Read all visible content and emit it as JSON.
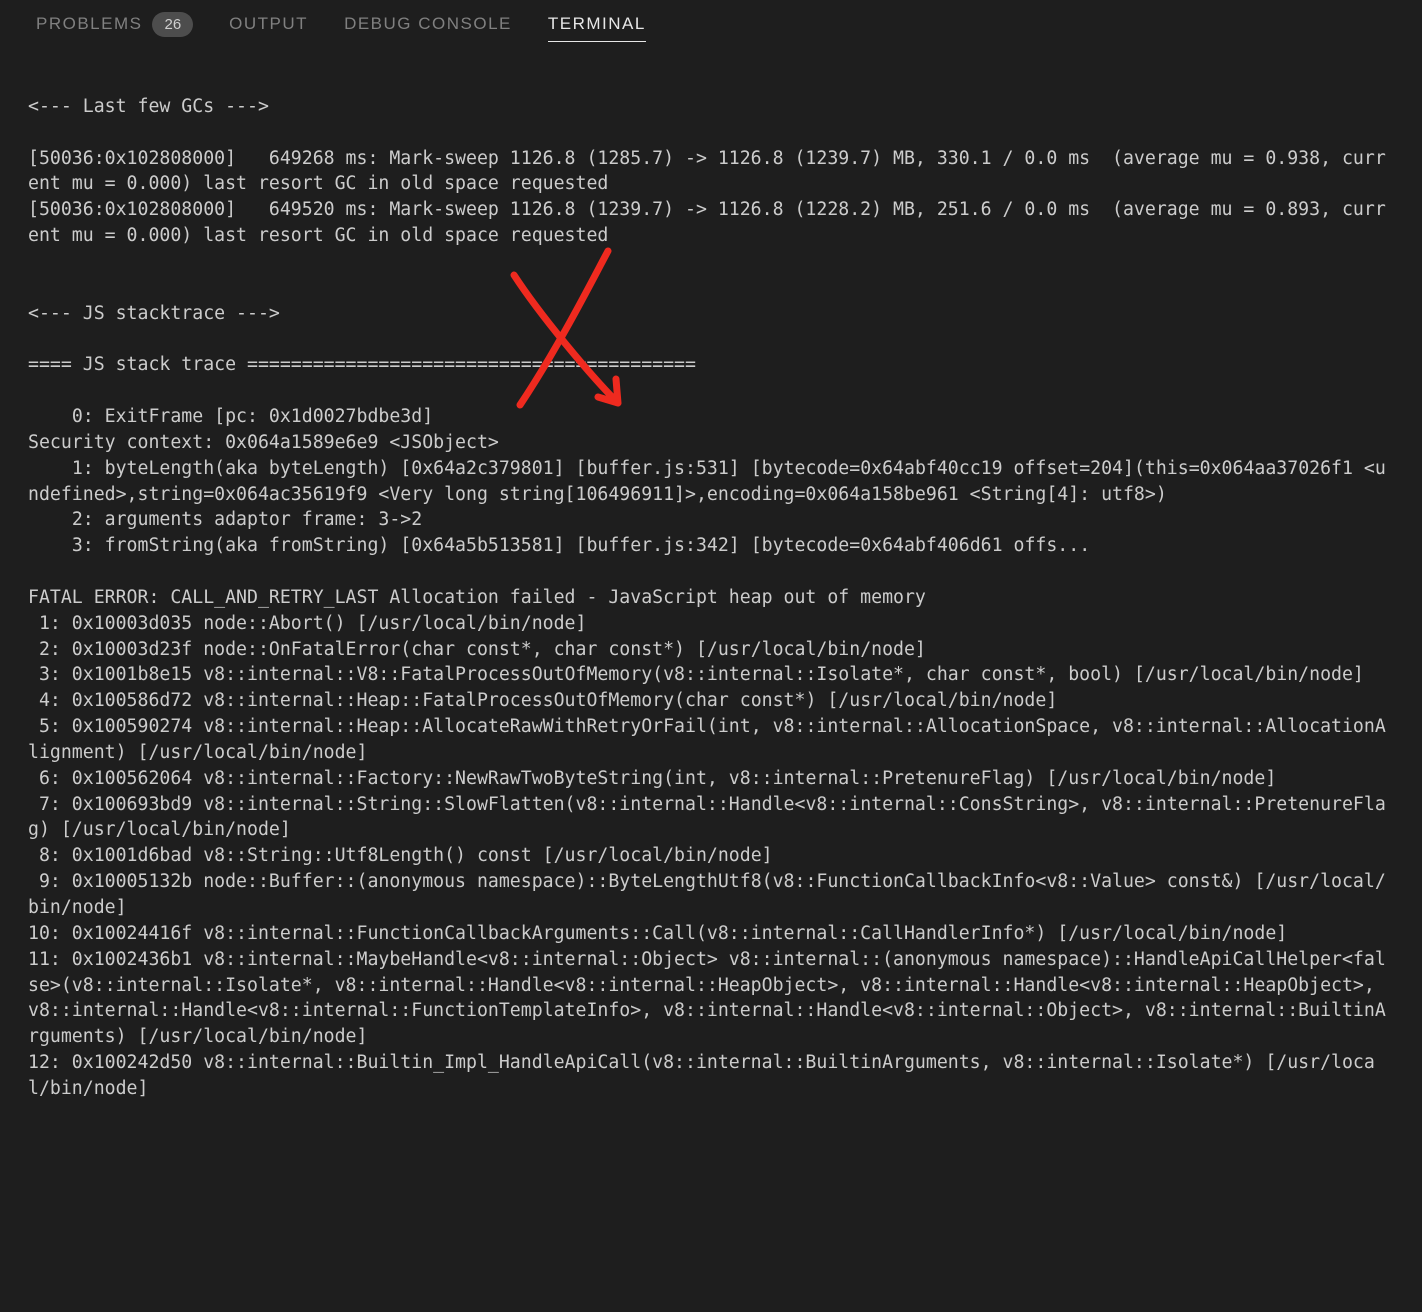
{
  "tabs": {
    "problems": {
      "label": "PROBLEMS",
      "badge": "26"
    },
    "output": {
      "label": "OUTPUT"
    },
    "debug": {
      "label": "DEBUG CONSOLE"
    },
    "terminal": {
      "label": "TERMINAL"
    }
  },
  "terminal_output": "\n<--- Last few GCs --->\n\n[50036:0x102808000]   649268 ms: Mark-sweep 1126.8 (1285.7) -> 1126.8 (1239.7) MB, 330.1 / 0.0 ms  (average mu = 0.938, current mu = 0.000) last resort GC in old space requested\n[50036:0x102808000]   649520 ms: Mark-sweep 1126.8 (1239.7) -> 1126.8 (1228.2) MB, 251.6 / 0.0 ms  (average mu = 0.893, current mu = 0.000) last resort GC in old space requested\n\n\n<--- JS stacktrace --->\n\n==== JS stack trace =========================================\n\n    0: ExitFrame [pc: 0x1d0027bdbe3d]\nSecurity context: 0x064a1589e6e9 <JSObject>\n    1: byteLength(aka byteLength) [0x64a2c379801] [buffer.js:531] [bytecode=0x64abf40cc19 offset=204](this=0x064aa37026f1 <undefined>,string=0x064ac35619f9 <Very long string[106496911]>,encoding=0x064a158be961 <String[4]: utf8>)\n    2: arguments adaptor frame: 3->2\n    3: fromString(aka fromString) [0x64a5b513581] [buffer.js:342] [bytecode=0x64abf406d61 offs...\n\nFATAL ERROR: CALL_AND_RETRY_LAST Allocation failed - JavaScript heap out of memory\n 1: 0x10003d035 node::Abort() [/usr/local/bin/node]\n 2: 0x10003d23f node::OnFatalError(char const*, char const*) [/usr/local/bin/node]\n 3: 0x1001b8e15 v8::internal::V8::FatalProcessOutOfMemory(v8::internal::Isolate*, char const*, bool) [/usr/local/bin/node]\n 4: 0x100586d72 v8::internal::Heap::FatalProcessOutOfMemory(char const*) [/usr/local/bin/node]\n 5: 0x100590274 v8::internal::Heap::AllocateRawWithRetryOrFail(int, v8::internal::AllocationSpace, v8::internal::AllocationAlignment) [/usr/local/bin/node]\n 6: 0x100562064 v8::internal::Factory::NewRawTwoByteString(int, v8::internal::PretenureFlag) [/usr/local/bin/node]\n 7: 0x100693bd9 v8::internal::String::SlowFlatten(v8::internal::Handle<v8::internal::ConsString>, v8::internal::PretenureFlag) [/usr/local/bin/node]\n 8: 0x1001d6bad v8::String::Utf8Length() const [/usr/local/bin/node]\n 9: 0x10005132b node::Buffer::(anonymous namespace)::ByteLengthUtf8(v8::FunctionCallbackInfo<v8::Value> const&) [/usr/local/bin/node]\n10: 0x10024416f v8::internal::FunctionCallbackArguments::Call(v8::internal::CallHandlerInfo*) [/usr/local/bin/node]\n11: 0x1002436b1 v8::internal::MaybeHandle<v8::internal::Object> v8::internal::(anonymous namespace)::HandleApiCallHelper<false>(v8::internal::Isolate*, v8::internal::Handle<v8::internal::HeapObject>, v8::internal::Handle<v8::internal::HeapObject>, v8::internal::Handle<v8::internal::FunctionTemplateInfo>, v8::internal::Handle<v8::internal::Object>, v8::internal::BuiltinArguments) [/usr/local/bin/node]\n12: 0x100242d50 v8::internal::Builtin_Impl_HandleApiCall(v8::internal::BuiltinArguments, v8::internal::Isolate*) [/usr/local/bin/node]"
}
